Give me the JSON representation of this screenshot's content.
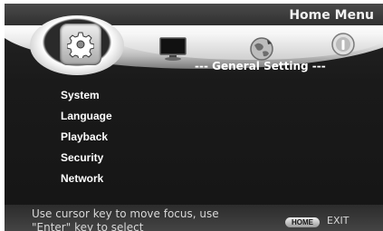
{
  "header": {
    "title": "Home Menu"
  },
  "icon_bar": {
    "selected": "gear-icon",
    "icons": [
      "gear-icon",
      "tv-icon",
      "globe-icon",
      "info-icon"
    ]
  },
  "section": {
    "title": "--- General Setting ---"
  },
  "menu": {
    "items": [
      {
        "label": "System"
      },
      {
        "label": "Language"
      },
      {
        "label": "Playback"
      },
      {
        "label": "Security"
      },
      {
        "label": "Network"
      }
    ]
  },
  "footer": {
    "hint_line1": "Use cursor key to move focus, use",
    "hint_line2": "\"Enter\" key to select",
    "home_key": "HOME",
    "exit_label": "EXIT"
  }
}
